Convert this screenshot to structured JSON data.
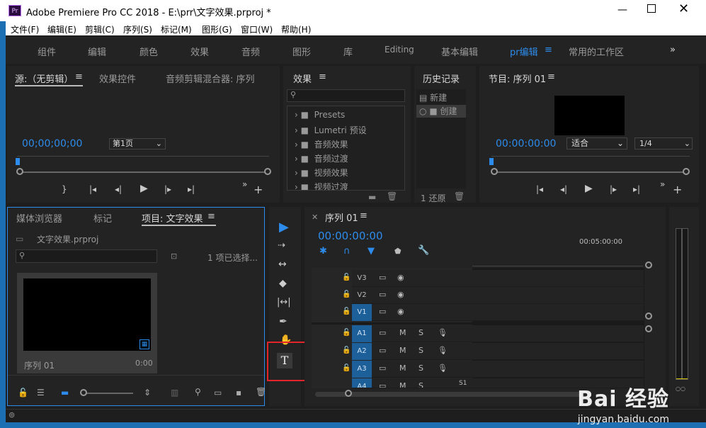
{
  "window": {
    "title": "Adobe Premiere Pro CC 2018 - E:\\prr\\文字效果.prproj *",
    "app_icon": "Pr"
  },
  "menu": [
    "文件(F)",
    "编辑(E)",
    "剪辑(C)",
    "序列(S)",
    "标记(M)",
    "图形(G)",
    "窗口(W)",
    "帮助(H)"
  ],
  "workspaces": [
    "组件",
    "编辑",
    "颜色",
    "效果",
    "音频",
    "图形",
    "库",
    "Editing",
    "基本编辑",
    "pr编辑",
    "常用的工作区"
  ],
  "source_panel": {
    "tabs": [
      "源:（无剪辑）",
      "效果控件",
      "音频剪辑混合器: 序列"
    ],
    "timecode": "00;00;00;00",
    "page_select": "第1页"
  },
  "effects_panel": {
    "title": "效果",
    "items": [
      "Presets",
      "Lumetri 预设",
      "音频效果",
      "音频过渡",
      "视频效果",
      "视频过渡"
    ]
  },
  "history_panel": {
    "title": "历史记录",
    "items": [
      "新建",
      "创建"
    ],
    "footer": "1 还原"
  },
  "program_panel": {
    "title": "节目: 序列 01",
    "timecode": "00:00:00:00",
    "fit": "适合",
    "res": "1/4"
  },
  "project_panel": {
    "tabs": [
      "媒体浏览器",
      "标记",
      "项目: 文字效果"
    ],
    "filename": "文字效果.prproj",
    "count": "1 项已选择...",
    "clip_name": "序列 01",
    "clip_duration": "0:00"
  },
  "timeline_panel": {
    "tab": "序列 01",
    "timecode": "00:00:00:00",
    "ruler_label": "00:05:00:00",
    "video_tracks": [
      "V3",
      "V2",
      "V1"
    ],
    "audio_tracks": [
      "A1",
      "A2",
      "A3",
      "A4"
    ],
    "marker": "S1"
  },
  "tools": [
    "selection",
    "track-select",
    "ripple-edit",
    "razor",
    "slip",
    "pen",
    "hand",
    "type"
  ],
  "watermark": {
    "text": "Bai 经验",
    "url": "jingyan.baidu.com"
  },
  "colors": {
    "accent": "#2d8ceb",
    "panel": "#232323",
    "highlight": "#e3242b"
  }
}
